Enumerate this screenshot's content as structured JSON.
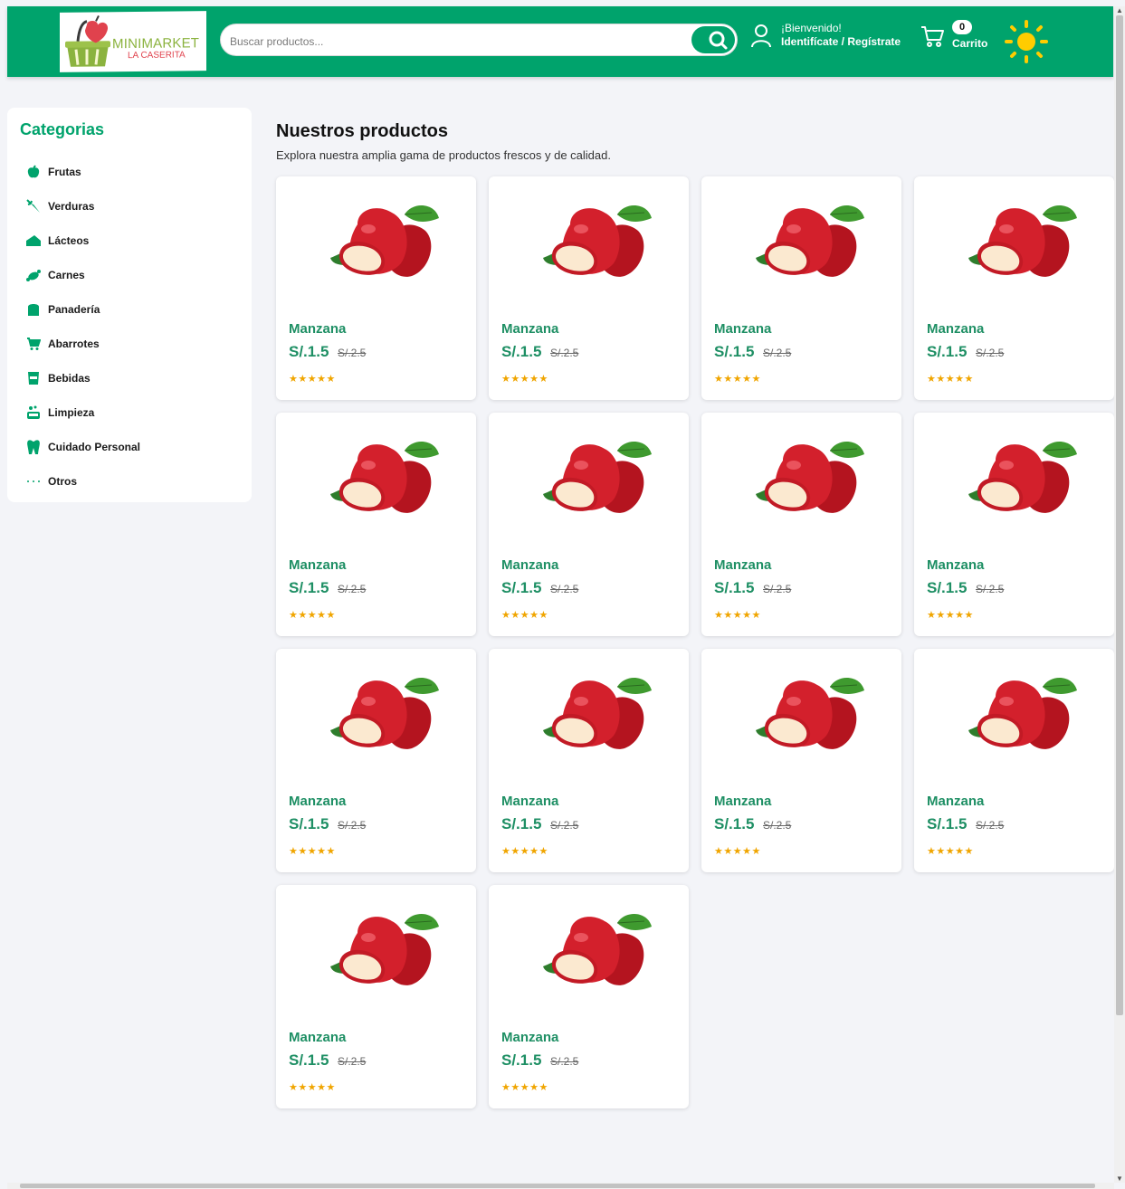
{
  "brand": {
    "name": "MINIMARKET",
    "tagline": "LA CASERITA",
    "colors": {
      "primary": "#00a36c",
      "accent_green": "#8bb33f",
      "accent_red": "#e0424d"
    }
  },
  "search": {
    "placeholder": "Buscar productos...",
    "value": "",
    "button_icon": "search-icon"
  },
  "account": {
    "greeting": "¡Bienvenido!",
    "action": "Identifícate / Regístrate",
    "icon": "user-icon"
  },
  "cart": {
    "count": "0",
    "label": "Carrito",
    "icon": "cart-icon"
  },
  "theme_toggle": {
    "icon": "sun-icon"
  },
  "sidebar": {
    "title": "Categorias",
    "items": [
      {
        "label": "Frutas",
        "icon": "apple-icon"
      },
      {
        "label": "Verduras",
        "icon": "carrot-icon"
      },
      {
        "label": "Lácteos",
        "icon": "cheese-icon"
      },
      {
        "label": "Carnes",
        "icon": "meat-icon"
      },
      {
        "label": "Panadería",
        "icon": "bread-icon"
      },
      {
        "label": "Abarrotes",
        "icon": "cart-small-icon"
      },
      {
        "label": "Bebidas",
        "icon": "drink-icon"
      },
      {
        "label": "Limpieza",
        "icon": "soap-icon"
      },
      {
        "label": "Cuidado Personal",
        "icon": "tooth-icon"
      },
      {
        "label": "Otros",
        "icon": "ellipsis-icon"
      }
    ]
  },
  "main": {
    "title": "Nuestros productos",
    "subtitle": "Explora nuestra amplia gama de productos frescos y de calidad.",
    "products": [
      {
        "name": "Manzana",
        "price": "S/.1.5",
        "old_price": "S/.2.5",
        "rating": 5,
        "stars": "★★★★★"
      },
      {
        "name": "Manzana",
        "price": "S/.1.5",
        "old_price": "S/.2.5",
        "rating": 5,
        "stars": "★★★★★"
      },
      {
        "name": "Manzana",
        "price": "S/.1.5",
        "old_price": "S/.2.5",
        "rating": 5,
        "stars": "★★★★★"
      },
      {
        "name": "Manzana",
        "price": "S/.1.5",
        "old_price": "S/.2.5",
        "rating": 5,
        "stars": "★★★★★"
      },
      {
        "name": "Manzana",
        "price": "S/.1.5",
        "old_price": "S/.2.5",
        "rating": 5,
        "stars": "★★★★★"
      },
      {
        "name": "Manzana",
        "price": "S/.1.5",
        "old_price": "S/.2.5",
        "rating": 5,
        "stars": "★★★★★"
      },
      {
        "name": "Manzana",
        "price": "S/.1.5",
        "old_price": "S/.2.5",
        "rating": 5,
        "stars": "★★★★★"
      },
      {
        "name": "Manzana",
        "price": "S/.1.5",
        "old_price": "S/.2.5",
        "rating": 5,
        "stars": "★★★★★"
      },
      {
        "name": "Manzana",
        "price": "S/.1.5",
        "old_price": "S/.2.5",
        "rating": 5,
        "stars": "★★★★★"
      },
      {
        "name": "Manzana",
        "price": "S/.1.5",
        "old_price": "S/.2.5",
        "rating": 5,
        "stars": "★★★★★"
      },
      {
        "name": "Manzana",
        "price": "S/.1.5",
        "old_price": "S/.2.5",
        "rating": 5,
        "stars": "★★★★★"
      },
      {
        "name": "Manzana",
        "price": "S/.1.5",
        "old_price": "S/.2.5",
        "rating": 5,
        "stars": "★★★★★"
      },
      {
        "name": "Manzana",
        "price": "S/.1.5",
        "old_price": "S/.2.5",
        "rating": 5,
        "stars": "★★★★★"
      },
      {
        "name": "Manzana",
        "price": "S/.1.5",
        "old_price": "S/.2.5",
        "rating": 5,
        "stars": "★★★★★"
      }
    ]
  }
}
